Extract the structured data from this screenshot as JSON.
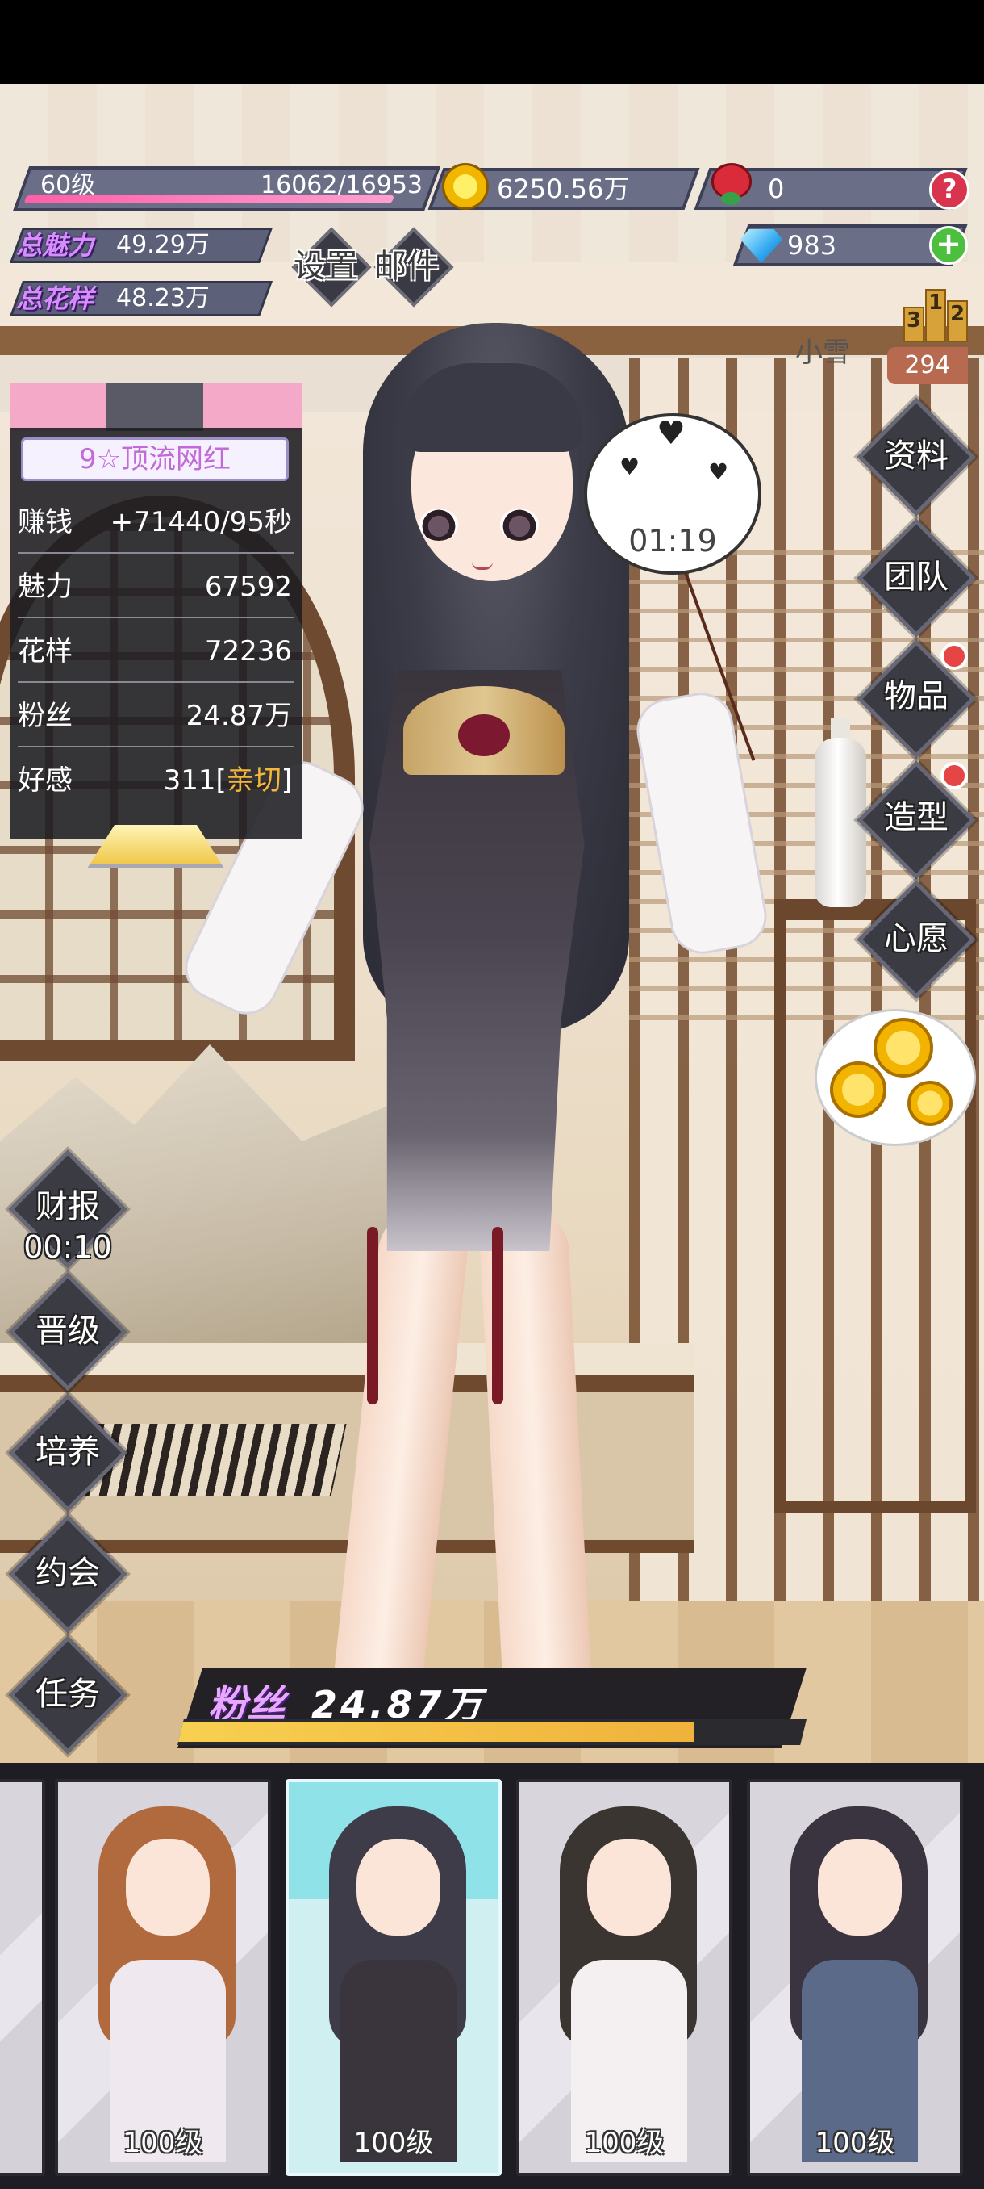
{
  "player": {
    "level": "60级",
    "exp": "16062/16953",
    "exp_fraction": 0.947,
    "coins": "6250.56万",
    "roses": "0",
    "gems": "983",
    "total_charm_label": "总魅力",
    "total_charm": "49.29万",
    "total_pattern_label": "总花样",
    "total_pattern": "48.23万"
  },
  "top_menu": {
    "settings": "设置",
    "mail": "邮件"
  },
  "ranking": {
    "name": "小雪",
    "score": "294",
    "podium": [
      "3",
      "1",
      "2"
    ]
  },
  "info_panel": {
    "title": "9☆顶流网红",
    "rows": [
      {
        "label": "赚钱",
        "value": "+71440/95秒"
      },
      {
        "label": "魅力",
        "value": "67592"
      },
      {
        "label": "花样",
        "value": "72236"
      },
      {
        "label": "粉丝",
        "value": "24.87万"
      },
      {
        "label": "好感",
        "value": "311",
        "bracket_open": "[",
        "highlight": "亲切",
        "bracket_close": "]"
      }
    ]
  },
  "timer_bubble": {
    "time": "01:19"
  },
  "right_menu": [
    "资料",
    "团队",
    "物品",
    "造型",
    "心愿"
  ],
  "left_menu": {
    "report_label": "财报",
    "report_timer": "00:10",
    "items": [
      "晋级",
      "培养",
      "约会",
      "任务"
    ]
  },
  "fans": {
    "label": "粉丝",
    "value": "24.87万",
    "progress": 0.82
  },
  "roster": [
    {
      "level": "100级",
      "hair": "#b06a3e",
      "outfit": "#efe8ee",
      "selected": false
    },
    {
      "level": "100级",
      "hair": "#3e3c48",
      "outfit": "#3a343c",
      "selected": true
    },
    {
      "level": "100级",
      "hair": "#3a3530",
      "outfit": "#f4f0f2",
      "selected": false
    },
    {
      "level": "100级",
      "hair": "#3a3340",
      "outfit": "#5a6a88",
      "selected": false
    }
  ],
  "colors": {
    "accent_gold": "#f3b73a",
    "badge_red": "#e54545",
    "panel_bg": "#1c1c22"
  }
}
